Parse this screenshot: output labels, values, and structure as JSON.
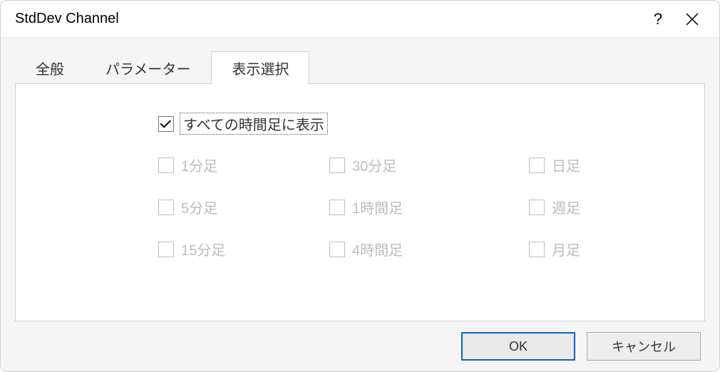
{
  "dialog": {
    "title": "StdDev Channel",
    "help_glyph": "?",
    "close_title": "Close"
  },
  "tabs": {
    "general": "全般",
    "parameters": "パラメーター",
    "display": "表示選択"
  },
  "master": {
    "label": "すべての時間足に表示",
    "checked": true
  },
  "options": {
    "m1": "1分足",
    "m5": "5分足",
    "m15": "15分足",
    "m30": "30分足",
    "h1": "1時間足",
    "h4": "4時間足",
    "d1": "日足",
    "w1": "週足",
    "mn1": "月足"
  },
  "buttons": {
    "ok": "OK",
    "cancel": "キャンセル"
  }
}
